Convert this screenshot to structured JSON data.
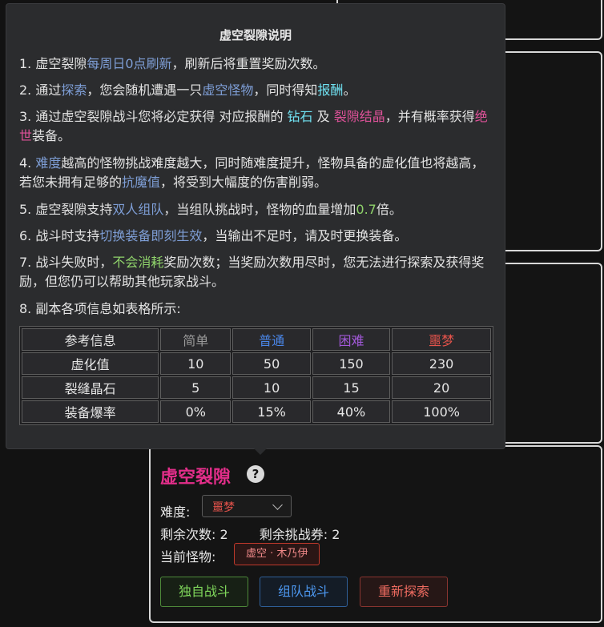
{
  "tooltip": {
    "title": "虚空裂隙说明",
    "lines": [
      [
        {
          "t": "1. 虚空裂隙"
        },
        {
          "t": "每周日0点刷新",
          "c": "hl-blue"
        },
        {
          "t": "，刷新后将重置奖励次数。"
        }
      ],
      [
        {
          "t": "2. 通过"
        },
        {
          "t": "探索",
          "c": "hl-blue"
        },
        {
          "t": "，您会随机遭遇一只"
        },
        {
          "t": "虚空怪物",
          "c": "hl-blue"
        },
        {
          "t": "，同时得知"
        },
        {
          "t": "报酬",
          "c": "hl-cyan"
        },
        {
          "t": "。"
        }
      ],
      [
        {
          "t": "3. 通过虚空裂隙战斗您将必定获得 对应报酬的 "
        },
        {
          "t": "钻石",
          "c": "hl-cyan"
        },
        {
          "t": " 及 "
        },
        {
          "t": "裂隙结晶",
          "c": "hl-pink"
        },
        {
          "t": "，并有概率获得"
        },
        {
          "t": "绝世",
          "c": "hl-pink"
        },
        {
          "t": "装备。"
        }
      ],
      [
        {
          "t": "4. "
        },
        {
          "t": "难度",
          "c": "hl-blue"
        },
        {
          "t": "越高的怪物挑战难度越大，同时随难度提升，怪物具备的虚化值也将越高，若您未拥有足够的"
        },
        {
          "t": "抗魔值",
          "c": "hl-blue"
        },
        {
          "t": "，将受到大幅度的伤害削弱。"
        }
      ],
      [
        {
          "t": "5. 虚空裂隙支持"
        },
        {
          "t": "双人组队",
          "c": "hl-blue"
        },
        {
          "t": "，当组队挑战时，怪物的血量增加"
        },
        {
          "t": "0.7",
          "c": "hl-green"
        },
        {
          "t": "倍。"
        }
      ],
      [
        {
          "t": "6. 战斗时支持"
        },
        {
          "t": "切换装备即刻生效",
          "c": "hl-blue"
        },
        {
          "t": "，当输出不足时，请及时更换装备。"
        }
      ],
      [
        {
          "t": "7. 战斗失败时，"
        },
        {
          "t": "不会消耗",
          "c": "hl-green"
        },
        {
          "t": "奖励次数；当奖励次数用尽时，您无法进行探索及获得奖励，但您仍可以帮助其他玩家战斗。"
        }
      ],
      [
        {
          "t": "8. 副本各项信息如表格所示:"
        }
      ]
    ],
    "table": {
      "headers": [
        "参考信息",
        "简单",
        "普通",
        "困难",
        "噩梦"
      ],
      "rows": [
        [
          "虚化值",
          "10",
          "50",
          "150",
          "230"
        ],
        [
          "裂缝晶石",
          "5",
          "10",
          "15",
          "20"
        ],
        [
          "装备爆率",
          "0%",
          "15%",
          "40%",
          "100%"
        ]
      ]
    }
  },
  "panel": {
    "title": "虚空裂隙",
    "help_icon": "question-circle-icon",
    "help_glyph": "?",
    "difficulty_label": "难度:",
    "difficulty_value": "噩梦",
    "remaining_label": "剩余次数:",
    "remaining_value": "2",
    "tickets_label": "剩余挑战券:",
    "tickets_value": "2",
    "monster_label": "当前怪物:",
    "monster_value": "虚空 · 木乃伊",
    "buttons": {
      "solo": "独自战斗",
      "team": "组队战斗",
      "reexplore": "重新探索"
    }
  },
  "colors": {
    "accent_pink": "#e32e8a",
    "easy": "#9a9a9a",
    "normal": "#4a86e8",
    "hard": "#a259d9",
    "nightmare": "#e5534b"
  }
}
